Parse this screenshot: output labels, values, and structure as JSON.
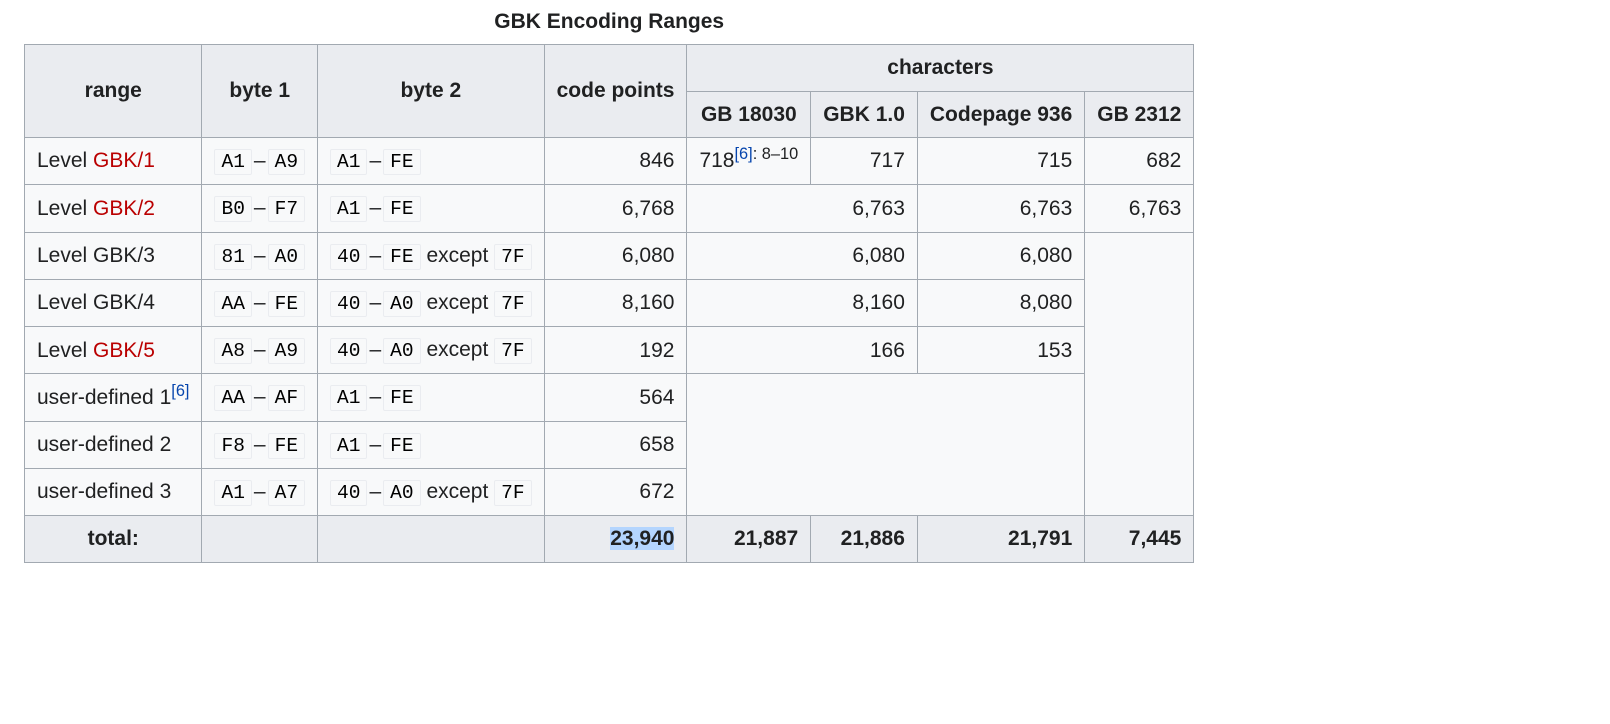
{
  "caption": "GBK Encoding Ranges",
  "headers": {
    "range": "range",
    "byte1": "byte 1",
    "byte2": "byte 2",
    "code_points": "code points",
    "characters": "characters",
    "gb18030": "GB 18030",
    "gbk10": "GBK 1.0",
    "cp936": "Codepage 936",
    "gb2312": "GB 2312"
  },
  "labels": {
    "level": "Level",
    "except": "except",
    "user_defined": "user-defined",
    "total": "total:",
    "dash": "–",
    "ref6": "[6]",
    "rp_810": ": 8–10 "
  },
  "rows": {
    "r1": {
      "link": "GBK/1",
      "b1a": "A1",
      "b1b": "A9",
      "b2a": "A1",
      "b2b": "FE",
      "b2except": "",
      "cp": "846",
      "gb18030": "718",
      "gbk10": "717",
      "cp936": "715",
      "gb2312": "682"
    },
    "r2": {
      "link": "GBK/2",
      "b1a": "B0",
      "b1b": "F7",
      "b2a": "A1",
      "b2b": "FE",
      "b2except": "",
      "cp": "6,768",
      "gbk10": "6,763",
      "cp936": "6,763",
      "gb2312": "6,763"
    },
    "r3": {
      "suffix": "GBK/3",
      "b1a": "81",
      "b1b": "A0",
      "b2a": "40",
      "b2b": "FE",
      "b2except": "7F",
      "cp": "6,080",
      "gbk10": "6,080",
      "cp936": "6,080"
    },
    "r4": {
      "suffix": "GBK/4",
      "b1a": "AA",
      "b1b": "FE",
      "b2a": "40",
      "b2b": "A0",
      "b2except": "7F",
      "cp": "8,160",
      "gbk10": "8,160",
      "cp936": "8,080"
    },
    "r5": {
      "link": "GBK/5",
      "b1a": "A8",
      "b1b": "A9",
      "b2a": "40",
      "b2b": "A0",
      "b2except": "7F",
      "cp": "192",
      "gbk10": "166",
      "cp936": "153"
    },
    "r6": {
      "n": "1",
      "b1a": "AA",
      "b1b": "AF",
      "b2a": "A1",
      "b2b": "FE",
      "b2except": "",
      "cp": "564"
    },
    "r7": {
      "n": "2",
      "b1a": "F8",
      "b1b": "FE",
      "b2a": "A1",
      "b2b": "FE",
      "b2except": "",
      "cp": "658"
    },
    "r8": {
      "n": "3",
      "b1a": "A1",
      "b1b": "A7",
      "b2a": "40",
      "b2b": "A0",
      "b2except": "7F",
      "cp": "672"
    }
  },
  "totals": {
    "cp": "23,940",
    "gb18030": "21,887",
    "gbk10": "21,886",
    "cp936": "21,791",
    "gb2312": "7,445"
  },
  "chart_data": {
    "type": "table",
    "title": "GBK Encoding Ranges",
    "columns": [
      "range",
      "byte 1",
      "byte 2",
      "code points",
      "GB 18030",
      "GBK 1.0",
      "Codepage 936",
      "GB 2312"
    ],
    "rows": [
      [
        "Level GBK/1",
        "A1–A9",
        "A1–FE",
        846,
        718,
        717,
        715,
        682
      ],
      [
        "Level GBK/2",
        "B0–F7",
        "A1–FE",
        6768,
        null,
        6763,
        6763,
        6763
      ],
      [
        "Level GBK/3",
        "81–A0",
        "40–FE except 7F",
        6080,
        null,
        6080,
        6080,
        null
      ],
      [
        "Level GBK/4",
        "AA–FE",
        "40–A0 except 7F",
        8160,
        null,
        8160,
        8080,
        null
      ],
      [
        "Level GBK/5",
        "A8–A9",
        "40–A0 except 7F",
        192,
        null,
        166,
        153,
        null
      ],
      [
        "user-defined 1",
        "AA–AF",
        "A1–FE",
        564,
        null,
        null,
        null,
        null
      ],
      [
        "user-defined 2",
        "F8–FE",
        "A1–FE",
        658,
        null,
        null,
        null,
        null
      ],
      [
        "user-defined 3",
        "A1–A7",
        "40–A0 except 7F",
        672,
        null,
        null,
        null,
        null
      ]
    ],
    "totals": {
      "code points": 23940,
      "GB 18030": 21887,
      "GBK 1.0": 21886,
      "Codepage 936": 21791,
      "GB 2312": 7445
    }
  }
}
